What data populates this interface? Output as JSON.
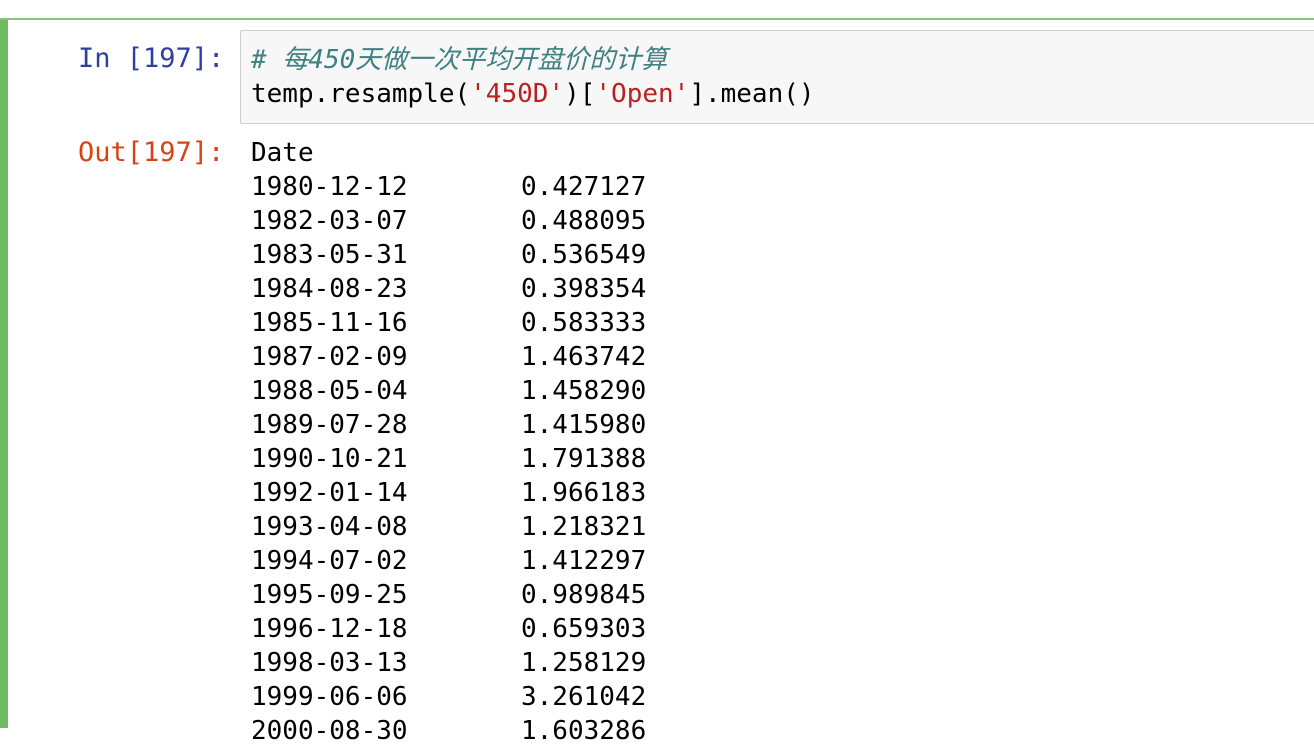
{
  "cell": {
    "in_prompt": "In [197]:",
    "out_prompt": "Out[197]:",
    "code": {
      "comment": "# 每450天做一次平均开盘价的计算",
      "line2_prefix": "temp.resample(",
      "line2_str1": "'450D'",
      "line2_mid": ")[",
      "line2_str2": "'Open'",
      "line2_suffix": "].mean()"
    }
  },
  "output": {
    "index_name": "Date",
    "rows": [
      {
        "date": "1980-12-12",
        "value": "0.427127"
      },
      {
        "date": "1982-03-07",
        "value": "0.488095"
      },
      {
        "date": "1983-05-31",
        "value": "0.536549"
      },
      {
        "date": "1984-08-23",
        "value": "0.398354"
      },
      {
        "date": "1985-11-16",
        "value": "0.583333"
      },
      {
        "date": "1987-02-09",
        "value": "1.463742"
      },
      {
        "date": "1988-05-04",
        "value": "1.458290"
      },
      {
        "date": "1989-07-28",
        "value": "1.415980"
      },
      {
        "date": "1990-10-21",
        "value": "1.791388"
      },
      {
        "date": "1992-01-14",
        "value": "1.966183"
      },
      {
        "date": "1993-04-08",
        "value": "1.218321"
      },
      {
        "date": "1994-07-02",
        "value": "1.412297"
      },
      {
        "date": "1995-09-25",
        "value": "0.989845"
      },
      {
        "date": "1996-12-18",
        "value": "0.659303"
      },
      {
        "date": "1998-03-13",
        "value": "1.258129"
      },
      {
        "date": "1999-06-06",
        "value": "3.261042"
      },
      {
        "date": "2000-08-30",
        "value": "1.603286"
      }
    ]
  },
  "colors": {
    "cell_bar": "#6fbb63",
    "in_prompt": "#303f9f",
    "out_prompt": "#d84315",
    "comment": "#408080",
    "string": "#ba2121"
  }
}
